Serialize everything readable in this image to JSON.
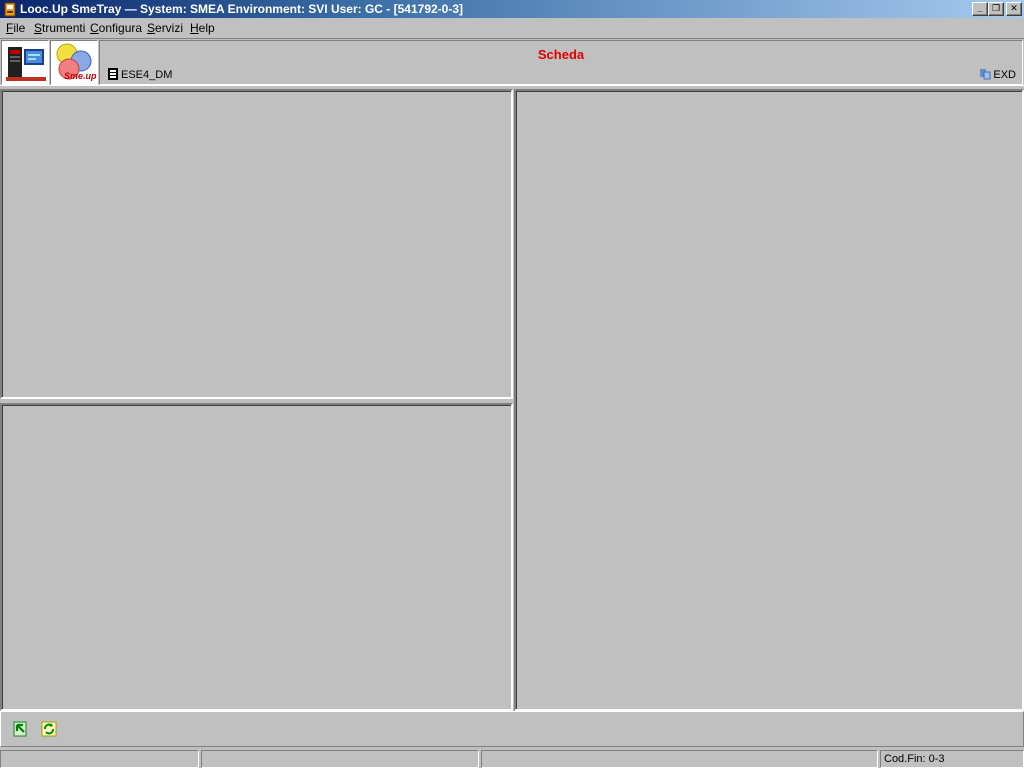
{
  "window": {
    "title": "Looc.Up SmeTray — System: SMEA Environment: SVI User: GC - [541792-0-3]",
    "controls": {
      "minimize": "_",
      "maximize": "❒",
      "close": "✕"
    }
  },
  "menu": {
    "items": [
      {
        "accel": "F",
        "rest": "ile"
      },
      {
        "accel": "S",
        "rest": "trumenti"
      },
      {
        "accel": "C",
        "rest": "onfigura"
      },
      {
        "accel": "S",
        "rest": "ervizi"
      },
      {
        "accel": "H",
        "rest": "elp"
      }
    ]
  },
  "header": {
    "title": "Scheda",
    "object_code": "ESE4_DM",
    "exd_label": "EXD",
    "logo_text": "Sme.up"
  },
  "colors": {
    "title_bar_start": "#0a246a",
    "title_bar_end": "#a6caf0",
    "scheda_title": "#e00000",
    "face": "#c0c0c0"
  },
  "status": {
    "panes": [
      "",
      "",
      "",
      "Cod.Fin: 0-3"
    ]
  }
}
